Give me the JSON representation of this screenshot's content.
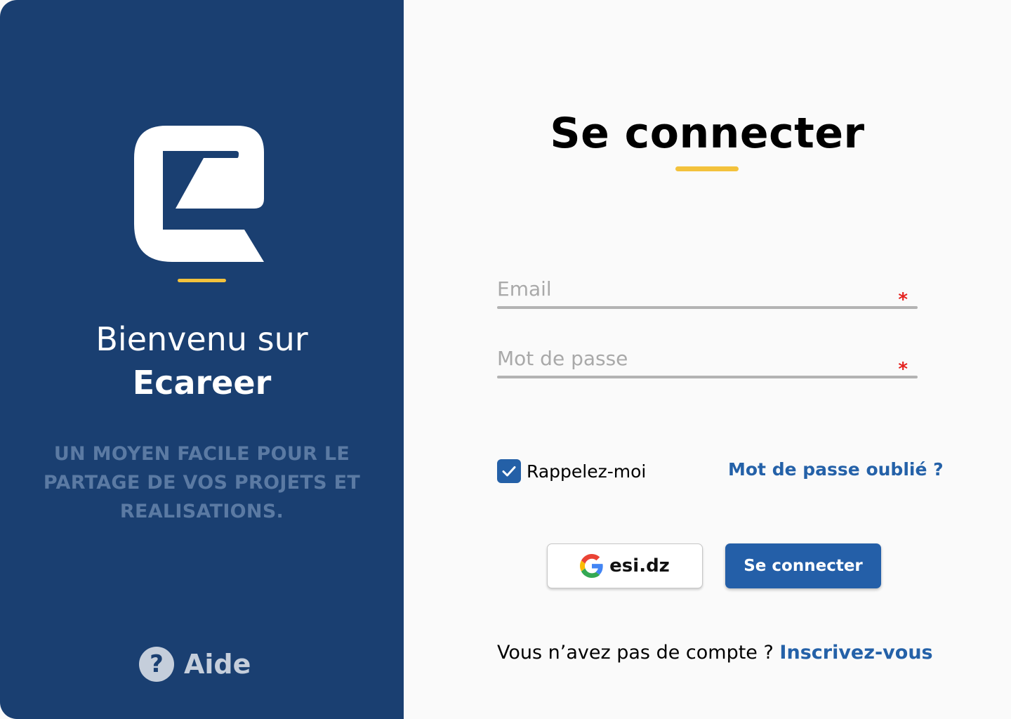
{
  "brand": {
    "logo_icon": "ecareer-logo-icon",
    "welcome_line1": "Bienvenu sur",
    "welcome_line2": "Ecareer",
    "tagline": "UN MOYEN FACILE POUR LE PARTAGE DE VOS PROJETS ET REALISATIONS.",
    "help_icon": "question-mark-icon",
    "help_label": "Aide",
    "primary_color": "#1a3f71",
    "accent_color": "#f3c23c"
  },
  "login": {
    "title": "Se connecter",
    "email": {
      "placeholder": "Email",
      "required_mark": "*"
    },
    "password": {
      "placeholder": "Mot de passe",
      "required_mark": "*"
    },
    "remember": {
      "label": "Rappelez-moi",
      "checked": true
    },
    "forgot_label": "Mot de passe oublié ?",
    "google_button": {
      "icon": "google-icon",
      "label": "esi.dz"
    },
    "submit_label": "Se connecter",
    "signup_prompt": "Vous n’avez pas de compte ?",
    "signup_link": "Inscrivez-vous",
    "link_color": "#2461a8"
  }
}
